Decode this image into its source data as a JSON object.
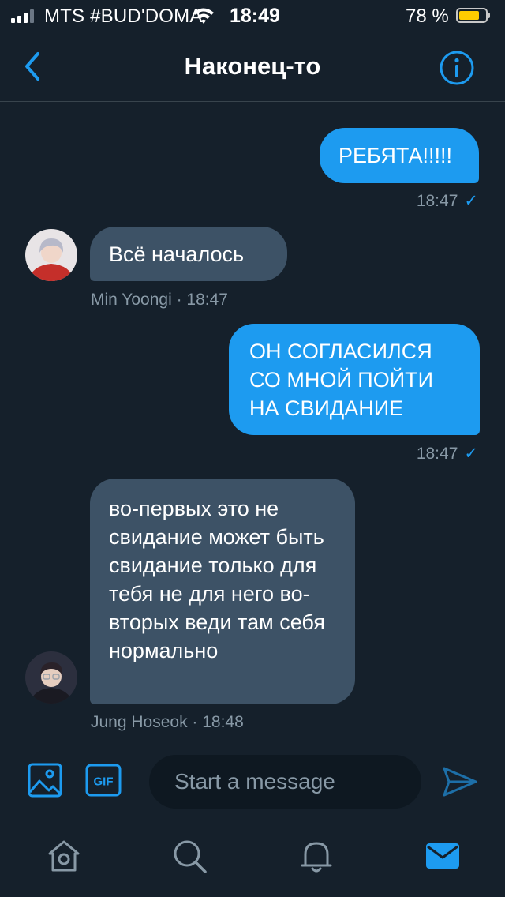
{
  "status_bar": {
    "carrier": "MTS #BUD'DOMA",
    "time": "18:49",
    "battery_percent": "78 %",
    "battery_level": 0.78,
    "signal_bars": 3,
    "icons": [
      "signal-icon",
      "wifi-icon",
      "battery-icon"
    ]
  },
  "header": {
    "title": "Наконец-то",
    "back_icon": "chevron-left-icon",
    "info_icon": "info-icon"
  },
  "messages": [
    {
      "direction": "outgoing",
      "text": "РЕБЯТА!!!!!",
      "time": "18:47",
      "status_icon": "✓"
    },
    {
      "direction": "incoming",
      "text": "Всё началось",
      "author": "Min Yoongi",
      "meta": "Min Yoongi · 18:47"
    },
    {
      "direction": "outgoing",
      "text": "ОН СОГЛАСИЛСЯ СО МНОЙ ПОЙТИ НА СВИДАНИЕ",
      "time": "18:47",
      "status_icon": "✓"
    },
    {
      "direction": "incoming",
      "text": "во-первых это не свидание может быть свидание только для тебя не для него во-вторых веди там себя нормально",
      "author": "Jung Hoseok",
      "meta": "Jung Hoseok · 18:48"
    }
  ],
  "composer": {
    "placeholder": "Start a message",
    "value": "",
    "gif_label": "GIF",
    "icons": [
      "image-icon",
      "gif-icon",
      "send-icon"
    ]
  },
  "tab_bar": {
    "tabs": [
      "home-icon",
      "search-icon",
      "bell-icon",
      "mail-icon"
    ],
    "active": "mail-icon"
  },
  "colors": {
    "background": "#15202b",
    "accent": "#1d9bf0",
    "incoming_bubble": "#3d5266",
    "secondary_text": "#8899a6",
    "divider": "#38444d",
    "battery_fill": "#ffcc00"
  }
}
